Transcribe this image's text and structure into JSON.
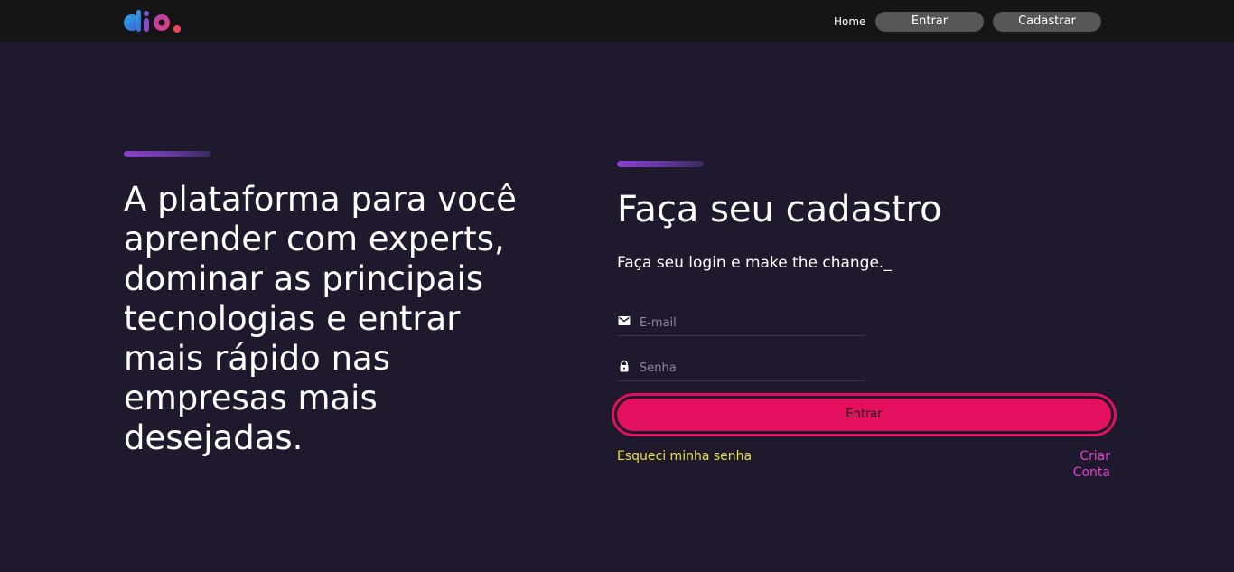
{
  "header": {
    "logo_icon": "dio-logo",
    "nav": {
      "home_label": "Home",
      "entrar_label": "Entrar",
      "cadastrar_label": "Cadastrar"
    }
  },
  "hero": {
    "text": "A plataforma para você aprender com experts, dominar as principais tecnologias e entrar mais rápido nas empresas mais desejadas."
  },
  "form": {
    "title": "Faça seu cadastro",
    "subtitle": "Faça seu login e make the change._",
    "email": {
      "icon": "mail-icon",
      "placeholder": "E-mail",
      "value": ""
    },
    "senha": {
      "icon": "lock-icon",
      "placeholder": "Senha",
      "value": ""
    },
    "submit_label": "Entrar",
    "forgot_label": "Esqueci minha senha",
    "create_label": "Criar Conta"
  },
  "colors": {
    "background": "#1e192c",
    "header": "#151515",
    "primary": "#e4105d",
    "forgot_link": "#e5e044",
    "create_link": "#e040d0"
  }
}
